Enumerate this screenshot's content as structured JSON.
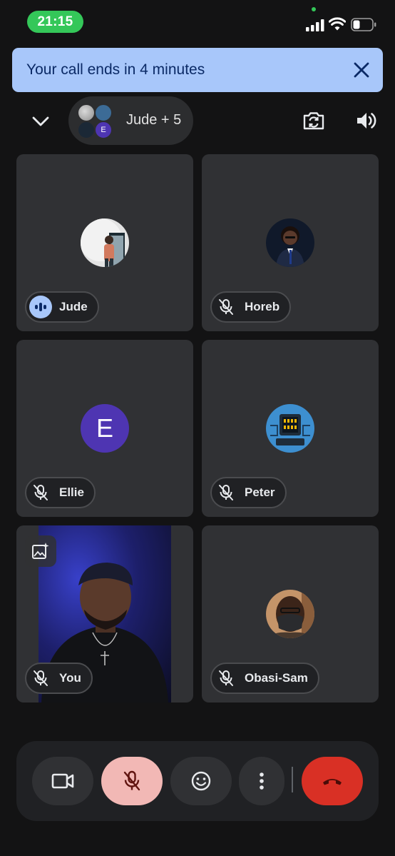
{
  "status_bar": {
    "time": "21:15",
    "time_pill_color": "#34c759"
  },
  "banner": {
    "text": "Your call ends in 4 minutes",
    "background": "#a8c7fa",
    "close_icon": "close-icon"
  },
  "header": {
    "participants_label": "Jude + 5",
    "mini_avatar_letter": "E",
    "icons": [
      "chevron-down-icon",
      "flip-camera-icon",
      "speaker-icon"
    ]
  },
  "tiles": [
    {
      "name": "Jude",
      "mic": "speaking",
      "avatar": "photo"
    },
    {
      "name": "Horeb",
      "mic": "muted",
      "avatar": "photo"
    },
    {
      "name": "Ellie",
      "mic": "muted",
      "avatar": "letter",
      "letter": "E",
      "avatar_color": "#4e35b2"
    },
    {
      "name": "Peter",
      "mic": "muted",
      "avatar": "photo"
    },
    {
      "name": "You",
      "mic": "muted",
      "avatar": "video"
    },
    {
      "name": "Obasi-Sam",
      "mic": "muted",
      "avatar": "photo"
    }
  ],
  "controls": {
    "camera": "video-camera-icon",
    "mic": "mic-off-icon",
    "emoji": "emoji-icon",
    "more": "more-vert-icon",
    "end": "call-end-icon",
    "end_color": "#d93025",
    "mic_color": "#f2b8b5"
  }
}
